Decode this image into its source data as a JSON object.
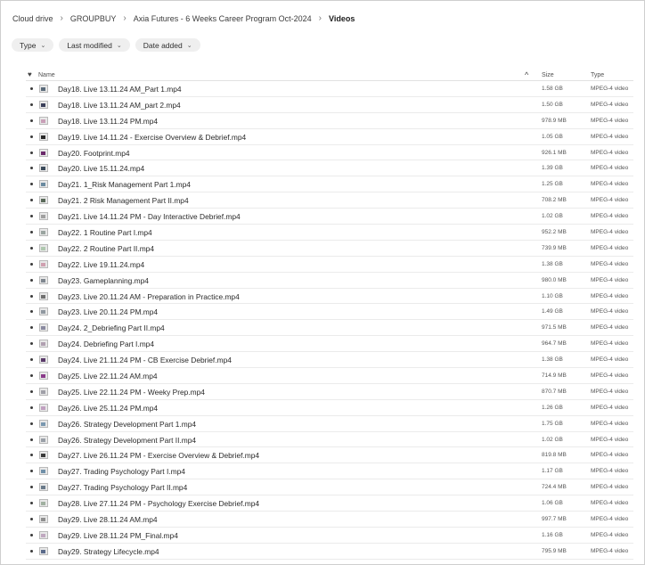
{
  "breadcrumb": [
    "Cloud drive",
    "GROUPBUY",
    "Axia Futures - 6 Weeks Career Program Oct-2024",
    "Videos"
  ],
  "filters": [
    "Type",
    "Last modified",
    "Date added"
  ],
  "columns": {
    "name": "Name",
    "size": "Size",
    "type": "Type"
  },
  "thumb_colors": [
    "#5a6a7a",
    "#3a3f5a",
    "#c9a0b8",
    "#2a2a2a",
    "#6b2a6b",
    "#3a4a5a",
    "#6a8aa0",
    "#5a6a5a",
    "#a0a0a0",
    "#9aa4a0",
    "#b0c8b0",
    "#d0a0b0",
    "#808890",
    "#707070",
    "#9098a0",
    "#8a8aa0",
    "#b0a0b0",
    "#5a3a6a",
    "#8a3a8a",
    "#a0a0a8",
    "#c0a0c0",
    "#7a98b0",
    "#9aa0a8",
    "#3a3a3a",
    "#7090a8",
    "#6a7a8a",
    "#a0b0a0",
    "#909090",
    "#c0a8c0",
    "#5a6a8a"
  ],
  "files": [
    {
      "name": "Day18. Live 13.11.24 AM_Part 1.mp4",
      "size": "1.58 GB",
      "type": "MPEG-4 video"
    },
    {
      "name": "Day18. Live 13.11.24 AM_part 2.mp4",
      "size": "1.50 GB",
      "type": "MPEG-4 video"
    },
    {
      "name": "Day18. Live 13.11.24 PM.mp4",
      "size": "978.9 MB",
      "type": "MPEG-4 video"
    },
    {
      "name": "Day19. Live 14.11.24 - Exercise Overview & Debrief.mp4",
      "size": "1.05 GB",
      "type": "MPEG-4 video"
    },
    {
      "name": "Day20. Footprint.mp4",
      "size": "926.1 MB",
      "type": "MPEG-4 video"
    },
    {
      "name": "Day20. Live 15.11.24.mp4",
      "size": "1.39 GB",
      "type": "MPEG-4 video"
    },
    {
      "name": "Day21. 1_Risk Management Part 1.mp4",
      "size": "1.25 GB",
      "type": "MPEG-4 video"
    },
    {
      "name": "Day21. 2 Risk Management Part II.mp4",
      "size": "708.2 MB",
      "type": "MPEG-4 video"
    },
    {
      "name": "Day21. Live 14.11.24 PM - Day Interactive Debrief.mp4",
      "size": "1.02 GB",
      "type": "MPEG-4 video"
    },
    {
      "name": "Day22. 1 Routine Part I.mp4",
      "size": "952.2 MB",
      "type": "MPEG-4 video"
    },
    {
      "name": "Day22. 2 Routine Part II.mp4",
      "size": "739.9 MB",
      "type": "MPEG-4 video"
    },
    {
      "name": "Day22. Live 19.11.24.mp4",
      "size": "1.38 GB",
      "type": "MPEG-4 video"
    },
    {
      "name": "Day23. Gameplanning.mp4",
      "size": "980.0 MB",
      "type": "MPEG-4 video"
    },
    {
      "name": "Day23. Live 20.11.24 AM - Preparation in Practice.mp4",
      "size": "1.10 GB",
      "type": "MPEG-4 video"
    },
    {
      "name": "Day23. Live 20.11.24 PM.mp4",
      "size": "1.49 GB",
      "type": "MPEG-4 video"
    },
    {
      "name": "Day24. 2_Debriefing Part II.mp4",
      "size": "971.5 MB",
      "type": "MPEG-4 video"
    },
    {
      "name": "Day24. Debriefing Part I.mp4",
      "size": "964.7 MB",
      "type": "MPEG-4 video"
    },
    {
      "name": "Day24. Live 21.11.24 PM - CB Exercise Debrief.mp4",
      "size": "1.38 GB",
      "type": "MPEG-4 video"
    },
    {
      "name": "Day25. Live 22.11.24 AM.mp4",
      "size": "714.9 MB",
      "type": "MPEG-4 video"
    },
    {
      "name": "Day25. Live 22.11.24 PM - Weeky Prep.mp4",
      "size": "870.7 MB",
      "type": "MPEG-4 video"
    },
    {
      "name": "Day26. Live 25.11.24 PM.mp4",
      "size": "1.26 GB",
      "type": "MPEG-4 video"
    },
    {
      "name": "Day26. Strategy Development Part 1.mp4",
      "size": "1.75 GB",
      "type": "MPEG-4 video"
    },
    {
      "name": "Day26. Strategy Development Part II.mp4",
      "size": "1.02 GB",
      "type": "MPEG-4 video"
    },
    {
      "name": "Day27. Live 26.11.24 PM - Exercise Overview & Debrief.mp4",
      "size": "819.8 MB",
      "type": "MPEG-4 video"
    },
    {
      "name": "Day27. Trading Psychology Part I.mp4",
      "size": "1.17 GB",
      "type": "MPEG-4 video"
    },
    {
      "name": "Day27. Trading Psychology Part II.mp4",
      "size": "724.4 MB",
      "type": "MPEG-4 video"
    },
    {
      "name": "Day28. Live 27.11.24 PM - Psychology Exercise Debrief.mp4",
      "size": "1.06 GB",
      "type": "MPEG-4 video"
    },
    {
      "name": "Day29. Live 28.11.24 AM.mp4",
      "size": "997.7 MB",
      "type": "MPEG-4 video"
    },
    {
      "name": "Day29. Live 28.11.24 PM_Final.mp4",
      "size": "1.16 GB",
      "type": "MPEG-4 video"
    },
    {
      "name": "Day29. Strategy Lifecycle.mp4",
      "size": "795.9 MB",
      "type": "MPEG-4 video"
    }
  ]
}
